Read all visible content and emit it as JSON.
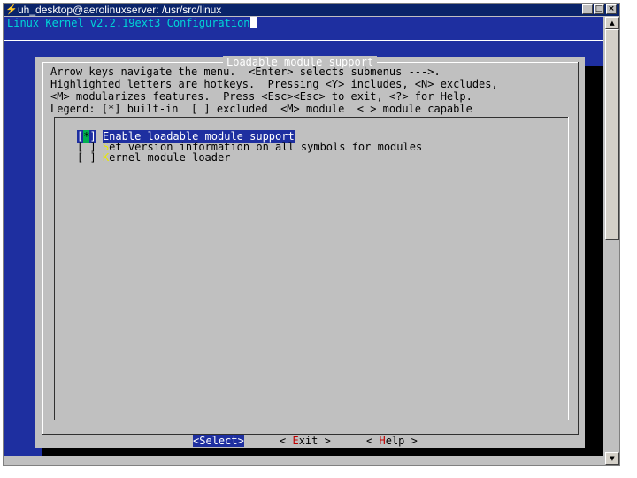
{
  "window": {
    "title": "uh_desktop@aerolinuxserver: /usr/src/linux",
    "buttons": {
      "minimize": "_",
      "maximize": "□",
      "close": "×"
    }
  },
  "terminal": {
    "header_title": "Linux Kernel v2.2.19ext3 Configuration"
  },
  "dialog": {
    "title": "Loadable module support",
    "help_lines": [
      "Arrow keys navigate the menu.  <Enter> selects submenus --->.",
      "Highlighted letters are hotkeys.  Pressing <Y> includes, <N> excludes,",
      "<M> modularizes features.  Press <Esc><Esc> to exit, <?> for Help.",
      "Legend: [*] built-in  [ ] excluded  <M> module  < > module capable"
    ],
    "menu_items": [
      {
        "open": "[",
        "mark": "*",
        "close": "]",
        "hotkey": "E",
        "rest": "nable loadable module support",
        "selected": true
      },
      {
        "open": "[",
        "mark": " ",
        "close": "]",
        "hotkey": "S",
        "rest": "et version information on all symbols for modules",
        "selected": false
      },
      {
        "open": "[",
        "mark": " ",
        "close": "]",
        "hotkey": "K",
        "rest": "ernel module loader",
        "selected": false
      }
    ],
    "buttons": {
      "select": "<Select>",
      "exit_pre": "< ",
      "exit_hot": "E",
      "exit_post": "xit >",
      "help_pre": "< ",
      "help_hot": "H",
      "help_post": "elp >"
    }
  },
  "colors": {
    "terminal_bg": "#1e2fa0",
    "dialog_bg": "#c0c0c0",
    "hotkey_yellow": "#e8e800",
    "hotkey_red": "#c00000",
    "title_cyan": "#00d6d6"
  }
}
